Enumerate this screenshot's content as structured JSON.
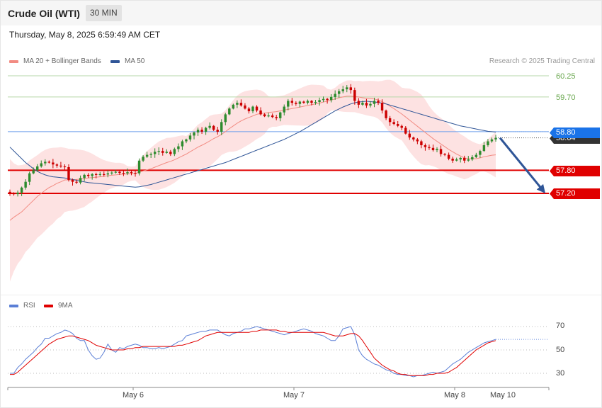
{
  "header": {
    "instrument": "Crude Oil (WTI)",
    "timeframe": "30 MIN"
  },
  "datetime": "Thursday, May 8, 2025 6:59:49 AM CET",
  "credit": "Research © 2025 Trading Central",
  "legend": {
    "ma20": {
      "label": "MA 20 + Bollinger Bands",
      "color": "#f28b82"
    },
    "ma50": {
      "label": "MA 50",
      "color": "#2f5597"
    },
    "rsi": {
      "label": "RSI",
      "color": "#5b7fd6"
    },
    "rsi_ma": {
      "label": "9MA",
      "color": "#e00000"
    }
  },
  "levels": {
    "l6025": {
      "label": "60.25",
      "color": "#6aa84f"
    },
    "l5970": {
      "label": "59.70",
      "color": "#6aa84f"
    },
    "l5880": {
      "label": "58.80",
      "color": "#1a73e8"
    },
    "l5864": {
      "label": "58.64",
      "color": "#333333"
    },
    "l5780": {
      "label": "57.80",
      "color": "#e00000"
    },
    "l5720": {
      "label": "57.20",
      "color": "#e00000"
    }
  },
  "rsi_ticks": [
    "70",
    "50",
    "30"
  ],
  "x_labels": [
    "May 6",
    "May 7",
    "May 8",
    "May 10"
  ],
  "chart_data": [
    {
      "type": "candlestick",
      "title": "Crude Oil (WTI)",
      "timeframe": "30 MIN",
      "ylim": [
        56.2,
        60.45
      ],
      "horizontal_levels": [
        60.25,
        59.7,
        58.8,
        57.8,
        57.2
      ],
      "last_price": 58.64,
      "forecast_arrow": {
        "from": 58.64,
        "to": 57.2
      },
      "close": [
        57.2,
        57.18,
        57.22,
        57.35,
        57.5,
        57.72,
        57.8,
        57.9,
        57.98,
        58.02,
        58.0,
        57.95,
        57.92,
        57.9,
        57.88,
        57.55,
        57.5,
        57.48,
        57.6,
        57.68,
        57.65,
        57.7,
        57.68,
        57.7,
        57.69,
        57.72,
        57.74,
        57.76,
        57.73,
        57.72,
        57.75,
        57.73,
        57.72,
        58.05,
        58.15,
        58.2,
        58.22,
        58.28,
        58.3,
        58.25,
        58.28,
        58.22,
        58.35,
        58.42,
        58.55,
        58.6,
        58.7,
        58.78,
        58.85,
        58.8,
        58.9,
        58.95,
        58.85,
        58.8,
        59.05,
        59.25,
        59.4,
        59.5,
        59.55,
        59.48,
        59.4,
        59.33,
        59.45,
        59.35,
        59.25,
        59.2,
        59.22,
        59.18,
        59.15,
        59.3,
        59.45,
        59.6,
        59.55,
        59.52,
        59.58,
        59.55,
        59.6,
        59.55,
        59.57,
        59.62,
        59.65,
        59.62,
        59.7,
        59.78,
        59.85,
        59.9,
        59.95,
        59.88,
        59.6,
        59.5,
        59.55,
        59.48,
        59.52,
        59.6,
        59.55,
        59.35,
        59.15,
        59.05,
        59.0,
        58.95,
        58.9,
        58.75,
        58.65,
        58.6,
        58.55,
        58.45,
        58.4,
        58.38,
        58.32,
        58.35,
        58.22,
        58.2,
        58.1,
        58.05,
        58.08,
        58.12,
        58.05,
        58.08,
        58.14,
        58.2,
        58.3,
        58.45,
        58.55,
        58.6,
        58.64
      ],
      "ma20": [
        56.5,
        56.58,
        56.65,
        56.72,
        56.82,
        56.92,
        57.02,
        57.12,
        57.2,
        57.28,
        57.35,
        57.4,
        57.46,
        57.5,
        57.55,
        57.55,
        57.55,
        57.56,
        57.57,
        57.58,
        57.6,
        57.61,
        57.62,
        57.63,
        57.64,
        57.66,
        57.67,
        57.68,
        57.69,
        57.7,
        57.7,
        57.71,
        57.72,
        57.75,
        57.78,
        57.81,
        57.84,
        57.88,
        57.92,
        57.96,
        58.0,
        58.03,
        58.07,
        58.12,
        58.17,
        58.22,
        58.28,
        58.34,
        58.4,
        58.45,
        58.5,
        58.56,
        58.62,
        58.67,
        58.73,
        58.8,
        58.88,
        58.95,
        59.02,
        59.08,
        59.13,
        59.17,
        59.21,
        59.25,
        59.27,
        59.28,
        59.3,
        59.31,
        59.32,
        59.34,
        59.36,
        59.38,
        59.4,
        59.42,
        59.44,
        59.46,
        59.48,
        59.5,
        59.52,
        59.54,
        59.57,
        59.59,
        59.62,
        59.65,
        59.68,
        59.7,
        59.72,
        59.72,
        59.71,
        59.7,
        59.68,
        59.67,
        59.66,
        59.65,
        59.62,
        59.58,
        59.52,
        59.46,
        59.4,
        59.33,
        59.26,
        59.18,
        59.1,
        59.02,
        58.94,
        58.86,
        58.78,
        58.7,
        58.62,
        58.55,
        58.48,
        58.41,
        58.34,
        58.28,
        58.22,
        58.17,
        58.12,
        58.1,
        58.1,
        58.1,
        58.12,
        58.15,
        58.17,
        58.19,
        58.2
      ],
      "ma50": [
        58.4,
        58.3,
        58.2,
        58.1,
        58.0,
        57.92,
        57.84,
        57.77,
        57.72,
        57.68,
        57.65,
        57.63,
        57.62,
        57.61,
        57.6,
        57.58,
        57.56,
        57.54,
        57.52,
        57.5,
        57.48,
        57.47,
        57.46,
        57.45,
        57.44,
        57.43,
        57.42,
        57.41,
        57.4,
        57.39,
        57.38,
        57.37,
        57.36,
        57.37,
        57.39,
        57.41,
        57.43,
        57.46,
        57.49,
        57.52,
        57.55,
        57.58,
        57.61,
        57.64,
        57.67,
        57.7,
        57.73,
        57.76,
        57.79,
        57.82,
        57.85,
        57.88,
        57.91,
        57.94,
        57.97,
        58.0,
        58.04,
        58.08,
        58.12,
        58.16,
        58.2,
        58.24,
        58.28,
        58.32,
        58.36,
        58.4,
        58.44,
        58.48,
        58.52,
        58.56,
        58.6,
        58.65,
        58.7,
        58.75,
        58.8,
        58.86,
        58.92,
        58.98,
        59.04,
        59.1,
        59.16,
        59.22,
        59.28,
        59.34,
        59.39,
        59.44,
        59.48,
        59.52,
        59.55,
        59.57,
        59.58,
        59.59,
        59.58,
        59.57,
        59.56,
        59.54,
        59.52,
        59.49,
        59.46,
        59.43,
        59.4,
        59.37,
        59.34,
        59.31,
        59.28,
        59.25,
        59.22,
        59.19,
        59.16,
        59.13,
        59.1,
        59.07,
        59.04,
        59.01,
        58.98,
        58.95,
        58.93,
        58.91,
        58.89,
        58.87,
        58.85,
        58.83,
        58.81,
        58.8,
        58.79
      ]
    },
    {
      "type": "line",
      "title": "RSI",
      "ylim": [
        20,
        80
      ],
      "yticks": [
        30,
        50,
        70
      ],
      "series": [
        {
          "name": "RSI",
          "values": [
            30,
            30,
            35,
            38,
            42,
            45,
            48,
            52,
            55,
            60,
            60,
            62,
            64,
            65,
            67,
            66,
            64,
            60,
            58,
            58,
            50,
            45,
            42,
            43,
            48,
            55,
            50,
            48,
            52,
            51,
            53,
            54,
            55,
            54,
            52,
            52,
            51,
            51,
            52,
            51,
            52,
            53,
            55,
            57,
            58,
            62,
            63,
            64,
            65,
            66,
            66,
            67,
            67,
            67,
            65,
            63,
            62,
            64,
            65,
            66,
            68,
            68,
            69,
            70,
            69,
            68,
            67,
            66,
            65,
            64,
            63,
            64,
            65,
            66,
            67,
            68,
            67,
            66,
            64,
            63,
            62,
            60,
            58,
            58,
            62,
            68,
            69,
            70,
            63,
            50,
            45,
            42,
            40,
            38,
            37,
            35,
            33,
            32,
            30,
            29,
            29,
            28,
            28,
            27,
            28,
            28,
            29,
            30,
            31,
            30,
            31,
            32,
            35,
            38,
            40,
            42,
            45,
            48,
            50,
            52,
            54,
            56,
            57,
            58,
            59
          ]
        },
        {
          "name": "9MA",
          "values": [
            29,
            29,
            31,
            34,
            37,
            40,
            43,
            46,
            49,
            52,
            55,
            57,
            59,
            60,
            61,
            62,
            62,
            61,
            60,
            59,
            58,
            56,
            54,
            53,
            52,
            51,
            50,
            50,
            50,
            50,
            51,
            51,
            52,
            52,
            53,
            53,
            53,
            53,
            53,
            53,
            53,
            53,
            53,
            54,
            54,
            55,
            56,
            57,
            58,
            60,
            62,
            63,
            64,
            65,
            65,
            65,
            65,
            65,
            65,
            65,
            65,
            65,
            66,
            66,
            67,
            67,
            67,
            67,
            67,
            66,
            66,
            65,
            65,
            65,
            65,
            65,
            65,
            65,
            65,
            65,
            65,
            64,
            63,
            62,
            62,
            62,
            63,
            64,
            64,
            62,
            58,
            53,
            48,
            43,
            40,
            37,
            35,
            33,
            32,
            30,
            29,
            29,
            28,
            28,
            28,
            28,
            28,
            29,
            29,
            30,
            30,
            30,
            31,
            33,
            35,
            38,
            41,
            44,
            47,
            50,
            52,
            54,
            56,
            57,
            58
          ]
        }
      ]
    }
  ]
}
